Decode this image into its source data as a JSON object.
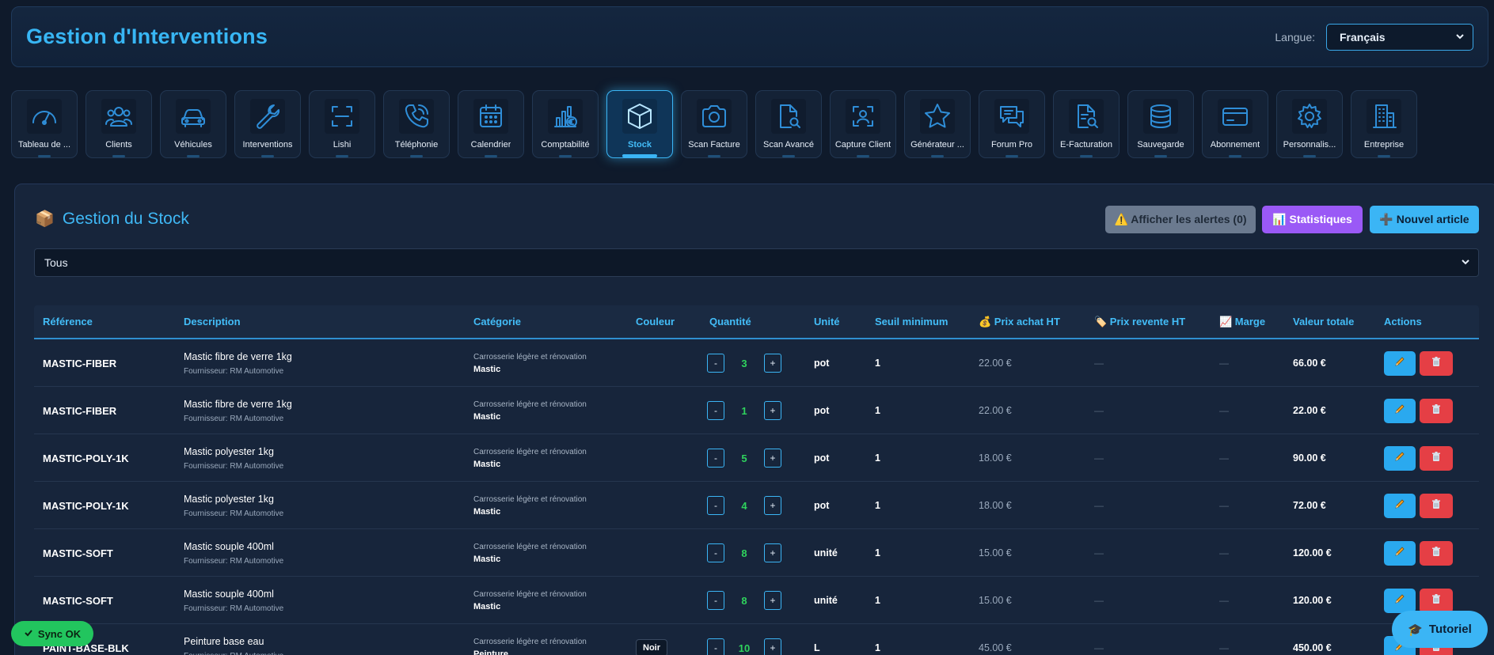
{
  "header": {
    "title": "Gestion d'Interventions",
    "lang_label": "Langue:",
    "lang_value": "Français"
  },
  "nav": {
    "items": [
      {
        "label": "Tableau de ...",
        "icon": "gauge-icon"
      },
      {
        "label": "Clients",
        "icon": "users-icon"
      },
      {
        "label": "Véhicules",
        "icon": "car-icon"
      },
      {
        "label": "Interventions",
        "icon": "wrench-icon"
      },
      {
        "label": "Lishi",
        "icon": "scan-frame-icon"
      },
      {
        "label": "Téléphonie",
        "icon": "phone-icon"
      },
      {
        "label": "Calendrier",
        "icon": "calendar-icon"
      },
      {
        "label": "Comptabilité",
        "icon": "chart-euro-icon"
      },
      {
        "label": "Stock",
        "icon": "box-icon"
      },
      {
        "label": "Scan Facture",
        "icon": "camera-icon"
      },
      {
        "label": "Scan Avancé",
        "icon": "doc-search-icon"
      },
      {
        "label": "Capture Client",
        "icon": "user-scan-icon"
      },
      {
        "label": "Générateur ...",
        "icon": "star-icon"
      },
      {
        "label": "Forum Pro",
        "icon": "chat-icon"
      },
      {
        "label": "E-Facturation",
        "icon": "invoice-search-icon"
      },
      {
        "label": "Sauvegarde",
        "icon": "database-icon"
      },
      {
        "label": "Abonnement",
        "icon": "credit-card-icon"
      },
      {
        "label": "Personnalis...",
        "icon": "gear-icon"
      },
      {
        "label": "Entreprise",
        "icon": "building-icon"
      }
    ],
    "active_index": 8
  },
  "stock": {
    "title": "Gestion du Stock",
    "title_icon": "📦",
    "alerts_label": "⚠️ Afficher les alertes (0)",
    "stats_label": "📊 Statistiques",
    "new_label": "➕ Nouvel article",
    "filter_value": "Tous"
  },
  "table": {
    "headers": {
      "reference": "Référence",
      "description": "Description",
      "category": "Catégorie",
      "color": "Couleur",
      "quantity": "Quantité",
      "unit": "Unité",
      "min_threshold": "Seuil minimum",
      "purchase_price": "💰 Prix achat HT",
      "resale_price": "🏷️ Prix revente HT",
      "margin": "📈 Marge",
      "total_value": "Valeur totale",
      "actions": "Actions"
    },
    "rows": [
      {
        "reference": "MASTIC-FIBER",
        "description": "Mastic fibre de verre 1kg",
        "supplier": "Fournisseur: RM Automotive",
        "category": "Carrosserie légère et rénovation",
        "subcategory": "Mastic",
        "color": "",
        "quantity": "3",
        "unit": "pot",
        "min": "1",
        "purchase": "22.00 €",
        "resale": "—",
        "margin": "—",
        "total": "66.00 €"
      },
      {
        "reference": "MASTIC-FIBER",
        "description": "Mastic fibre de verre 1kg",
        "supplier": "Fournisseur: RM Automotive",
        "category": "Carrosserie légère et rénovation",
        "subcategory": "Mastic",
        "color": "",
        "quantity": "1",
        "unit": "pot",
        "min": "1",
        "purchase": "22.00 €",
        "resale": "—",
        "margin": "—",
        "total": "22.00 €"
      },
      {
        "reference": "MASTIC-POLY-1K",
        "description": "Mastic polyester 1kg",
        "supplier": "Fournisseur: RM Automotive",
        "category": "Carrosserie légère et rénovation",
        "subcategory": "Mastic",
        "color": "",
        "quantity": "5",
        "unit": "pot",
        "min": "1",
        "purchase": "18.00 €",
        "resale": "—",
        "margin": "—",
        "total": "90.00 €"
      },
      {
        "reference": "MASTIC-POLY-1K",
        "description": "Mastic polyester 1kg",
        "supplier": "Fournisseur: RM Automotive",
        "category": "Carrosserie légère et rénovation",
        "subcategory": "Mastic",
        "color": "",
        "quantity": "4",
        "unit": "pot",
        "min": "1",
        "purchase": "18.00 €",
        "resale": "—",
        "margin": "—",
        "total": "72.00 €"
      },
      {
        "reference": "MASTIC-SOFT",
        "description": "Mastic souple 400ml",
        "supplier": "Fournisseur: RM Automotive",
        "category": "Carrosserie légère et rénovation",
        "subcategory": "Mastic",
        "color": "",
        "quantity": "8",
        "unit": "unité",
        "min": "1",
        "purchase": "15.00 €",
        "resale": "—",
        "margin": "—",
        "total": "120.00 €"
      },
      {
        "reference": "MASTIC-SOFT",
        "description": "Mastic souple 400ml",
        "supplier": "Fournisseur: RM Automotive",
        "category": "Carrosserie légère et rénovation",
        "subcategory": "Mastic",
        "color": "",
        "quantity": "8",
        "unit": "unité",
        "min": "1",
        "purchase": "15.00 €",
        "resale": "—",
        "margin": "—",
        "total": "120.00 €"
      },
      {
        "reference": "PAINT-BASE-BLK",
        "description": "Peinture base eau",
        "supplier": "Fournisseur: RM Automotive",
        "category": "Carrosserie légère et rénovation",
        "subcategory": "Peinture",
        "color": "Noir",
        "quantity": "10",
        "unit": "L",
        "min": "1",
        "purchase": "45.00 €",
        "resale": "—",
        "margin": "—",
        "total": "450.00 €"
      }
    ],
    "qty_minus": "-",
    "qty_plus": "+"
  },
  "status": {
    "sync_label": "Sync OK",
    "tutorial_label": "Tutoriel"
  },
  "colors": {
    "accent": "#3bb5f5",
    "purple": "#9a59f6",
    "danger": "#e53f45",
    "success": "#22c55e",
    "background": "#0f1a2b"
  }
}
